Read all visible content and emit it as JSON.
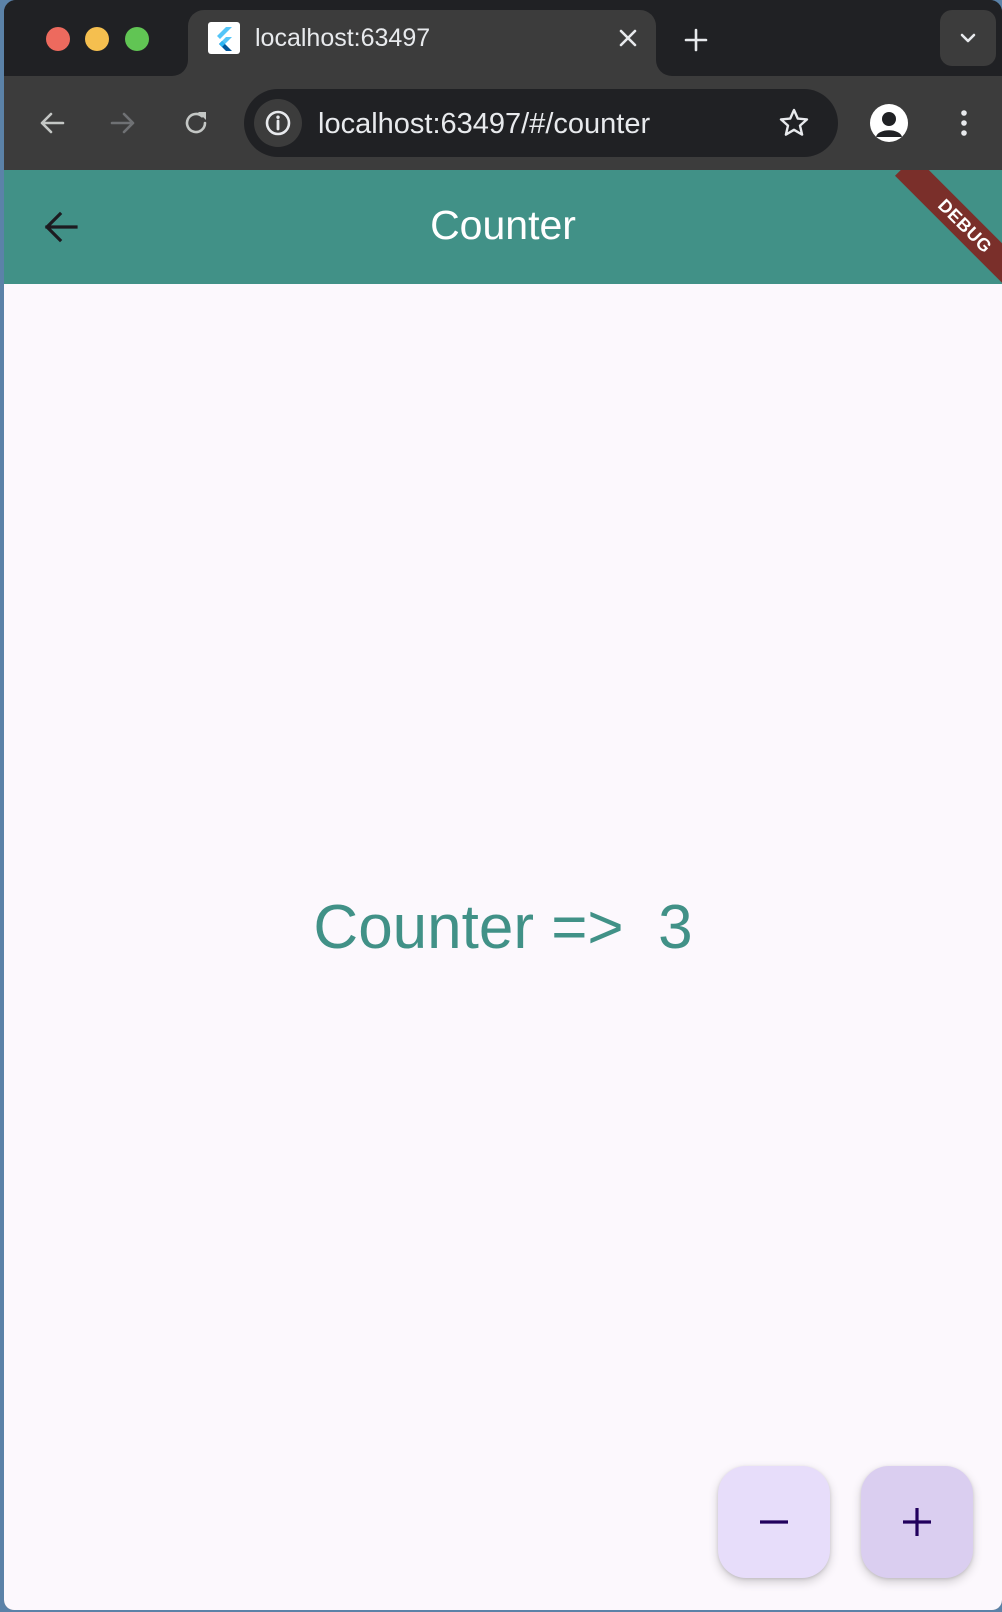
{
  "browser": {
    "tab": {
      "title": "localhost:63497",
      "favicon": "flutter-icon"
    },
    "address_bar": {
      "url": "localhost:63497/#/counter"
    },
    "icons": {
      "back": "arrow-left-icon",
      "forward": "arrow-right-icon",
      "reload": "reload-icon",
      "site_info": "info-icon",
      "bookmark": "star-icon",
      "profile": "profile-icon",
      "menu": "more-vert-icon",
      "new_tab": "plus-icon",
      "tab_search": "chevron-down-icon",
      "tab_close": "close-icon"
    }
  },
  "app": {
    "appbar": {
      "title": "Counter",
      "back_icon": "arrow-back-icon"
    },
    "debug_banner": "DEBUG",
    "counter": {
      "text": "Counter =>  3",
      "value": 3
    },
    "fabs": {
      "decrement_symbol": "−",
      "increment_symbol": "+"
    },
    "colors": {
      "primary": "#419187",
      "background": "#fcf8fd",
      "fab_decrement": "#e7ddfa",
      "fab_increment": "#dacef0",
      "debug_banner": "#7a2f2a"
    }
  }
}
